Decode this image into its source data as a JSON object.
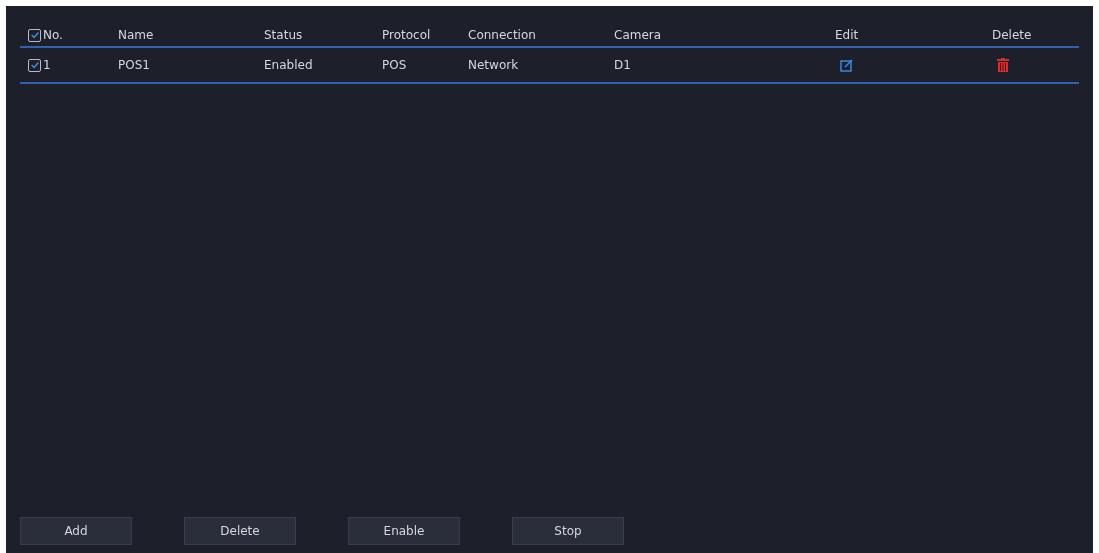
{
  "table": {
    "select_all_checked": true,
    "columns": [
      "No.",
      "Name",
      "Status",
      "Protocol",
      "Connection",
      "Camera",
      "Edit",
      "Delete"
    ],
    "rows": [
      {
        "checked": true,
        "cells": [
          "1",
          "POS1",
          "Enabled",
          "POS",
          "Network",
          "D1"
        ]
      }
    ]
  },
  "buttons": [
    "Add",
    "Delete",
    "Enable",
    "Stop"
  ]
}
